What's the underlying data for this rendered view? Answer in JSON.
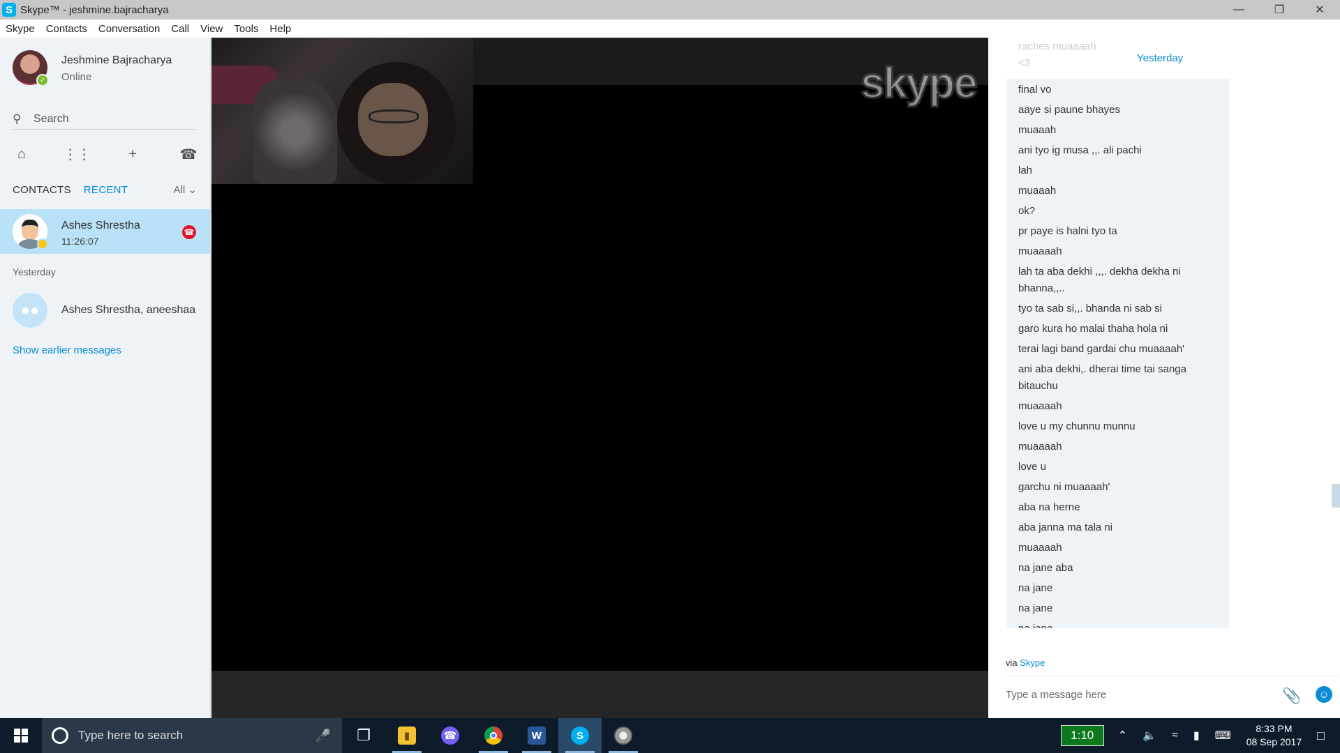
{
  "window": {
    "title": "Skype™ - jeshmine.bajracharya",
    "app_icon_letter": "S"
  },
  "menu": [
    "Skype",
    "Contacts",
    "Conversation",
    "Call",
    "View",
    "Tools",
    "Help"
  ],
  "profile": {
    "name": "Jeshmine Bajracharya",
    "status": "Online"
  },
  "search": {
    "placeholder": "Search"
  },
  "tabs": {
    "contacts": "CONTACTS",
    "recent": "RECENT",
    "filter": "All"
  },
  "recent": {
    "active_call": {
      "name": "Ashes Shrestha",
      "duration": "11:26:07"
    },
    "group_label": "Yesterday",
    "group": {
      "name": "Ashes Shrestha, aneeshaa"
    },
    "show_earlier": "Show earlier messages"
  },
  "video": {
    "watermark": "skype"
  },
  "chat": {
    "date_header": "Yesterday",
    "faded_top": [
      "raches muaaaah",
      "<3"
    ],
    "messages": [
      "final vo",
      "aaye si paune bhayes",
      "muaaah",
      "ani tyo ig musa ,,. ali pachi",
      "lah",
      "muaaah",
      "ok?",
      "pr paye is halni tyo ta",
      "muaaaah",
      "lah ta aba dekhi ,,,. dekha dekha ni bhanna,,..",
      "tyo ta sab si,,. bhanda ni sab si",
      "garo kura ho malai thaha hola ni",
      "terai lagi band gardai chu muaaaah'",
      "ani aba dekhi,. dherai time tai sanga bitauchu",
      "muaaaah",
      "love u my chunnu munnu",
      "muaaaah",
      "love u",
      "garchu ni muaaaah'",
      "aba na herne",
      "aba janna ma tala ni",
      "muaaaah",
      "na jane aba",
      "na jane",
      "na jane",
      "na jane"
    ],
    "via_prefix": "via",
    "via_link": "Skype",
    "compose_placeholder": "Type a message here"
  },
  "taskbar": {
    "search_placeholder": "Type here to search",
    "timer": "1:10",
    "time": "8:33 PM",
    "date": "08 Sep 2017",
    "apps": [
      "task-view",
      "file-explorer",
      "viber",
      "chrome",
      "word",
      "skype",
      "media-player"
    ]
  },
  "colors": {
    "accent": "#0a8bd6",
    "selected_row": "#b9e2f8",
    "sidebar_bg": "#eef3f7",
    "hangup": "#e81123",
    "online": "#7dbb2e",
    "taskbar": "#0e1b2b"
  }
}
